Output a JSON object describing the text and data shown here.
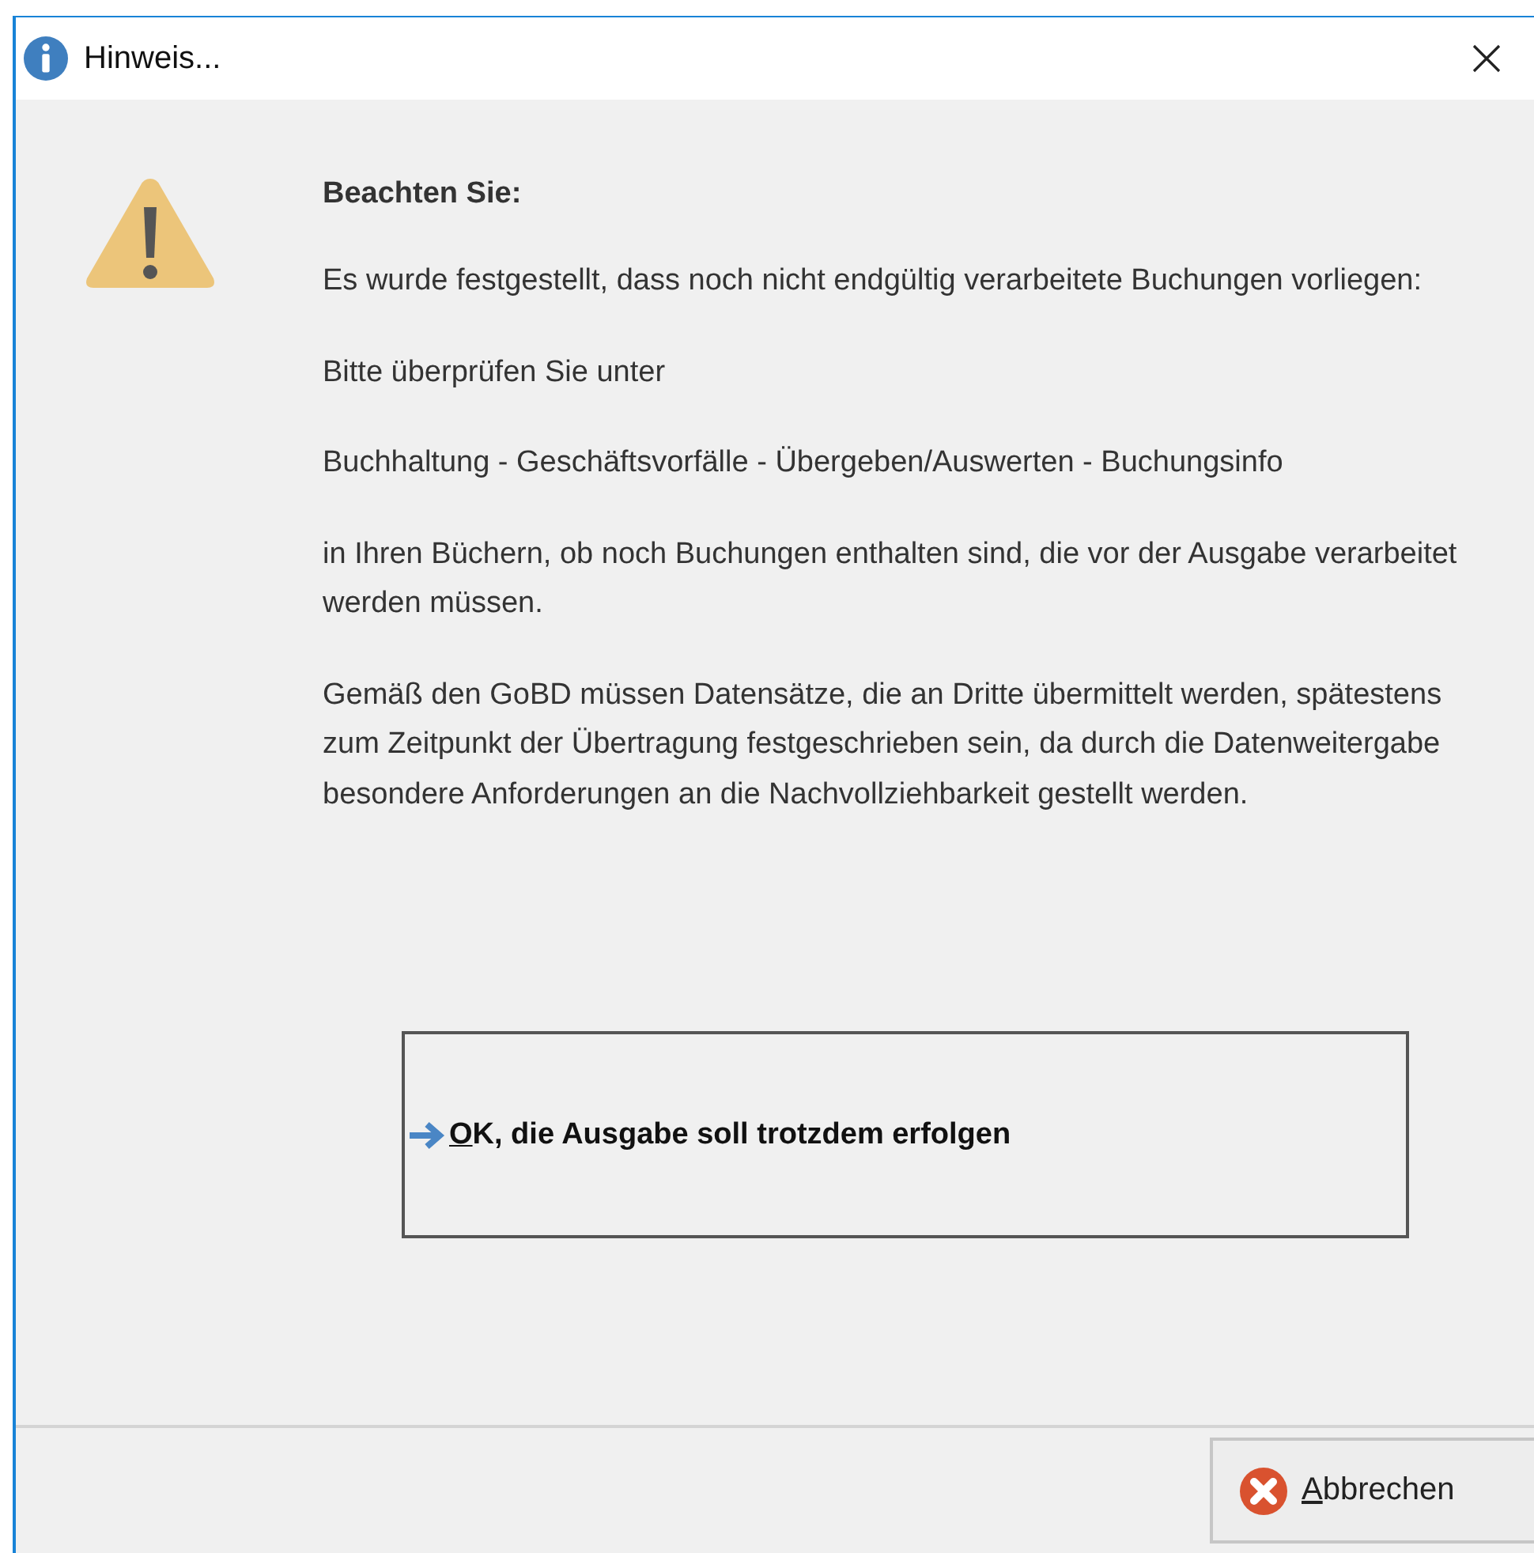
{
  "window": {
    "title": "Hinweis..."
  },
  "message": {
    "heading": "Beachten Sie:",
    "paragraphs": [
      "Es wurde festgestellt, dass noch nicht endgültig verarbeitete Buchungen vorliegen:",
      "Bitte überprüfen Sie unter",
      "Buchhaltung - Geschäftsvorfälle - Übergeben/Auswerten - Buchungsinfo",
      "in Ihren Büchern, ob noch Buchungen enthalten sind, die vor der Ausgabe verarbeitet werden müssen.",
      "Gemäß den GoBD müssen Datensätze, die an Dritte übermittelt werden, spätestens zum Zeitpunkt der Übertragung festgeschrieben sein, da durch die Datenweitergabe besondere Anforderungen an die Nachvollziehbarkeit gestellt werden."
    ]
  },
  "command_button": {
    "access_key": "O",
    "label_rest": "K, die Ausgabe soll trotzdem erfolgen"
  },
  "cancel_button": {
    "access_key": "A",
    "label_rest": "bbrechen"
  }
}
